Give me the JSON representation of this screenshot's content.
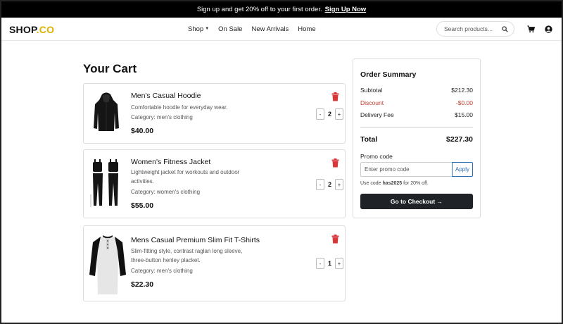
{
  "promo_bar": {
    "text": "Sign up and get 20% off to your first order.",
    "link": "Sign Up Now"
  },
  "header": {
    "logo_main": "SHOP",
    "logo_accent": ".CO",
    "nav": [
      {
        "label": "Shop",
        "has_dropdown": true
      },
      {
        "label": "On Sale"
      },
      {
        "label": "New Arrivals"
      },
      {
        "label": "Home"
      }
    ],
    "search_placeholder": "Search products...",
    "icons": [
      "search-icon",
      "cart-icon",
      "user-icon"
    ]
  },
  "cart": {
    "title": "Your Cart",
    "items": [
      {
        "name": "Men's Casual Hoodie",
        "desc": "Comfortable hoodie for everyday wear.",
        "category": "Category: men's clothing",
        "price": "$40.00",
        "qty": "2",
        "icon": "hoodie-image"
      },
      {
        "name": "Women's Fitness Jacket",
        "desc": "Lightweight jacket for workouts and outdoor activities.",
        "category": "Category: women's clothing",
        "price": "$55.00",
        "qty": "2",
        "icon": "fitness-set-image"
      },
      {
        "name": "Mens Casual Premium Slim Fit T-Shirts",
        "desc": "Slim-fitting style, contrast raglan long sleeve, three-button henley placket.",
        "category": "Category: men's clothing",
        "price": "$22.30",
        "qty": "1",
        "icon": "henley-shirt-image"
      }
    ],
    "minus_label": "-",
    "plus_label": "+"
  },
  "summary": {
    "title": "Order Summary",
    "subtotal_label": "Subtotal",
    "subtotal": "$212.30",
    "discount_label": "Discount",
    "discount": "-$0.00",
    "delivery_label": "Delivery Fee",
    "delivery": "$15.00",
    "total_label": "Total",
    "total": "$227.30",
    "promo_label": "Promo code",
    "promo_placeholder": "Enter promo code",
    "apply_label": "Apply",
    "hint_prefix": "Use code ",
    "hint_code": "has2025",
    "hint_suffix": " for 20% off.",
    "checkout_label": "Go to Checkout →"
  },
  "colors": {
    "accent": "#e0b100",
    "danger": "#c0392b",
    "link_blue": "#2f6fb5",
    "button_dark": "#1f2226"
  }
}
